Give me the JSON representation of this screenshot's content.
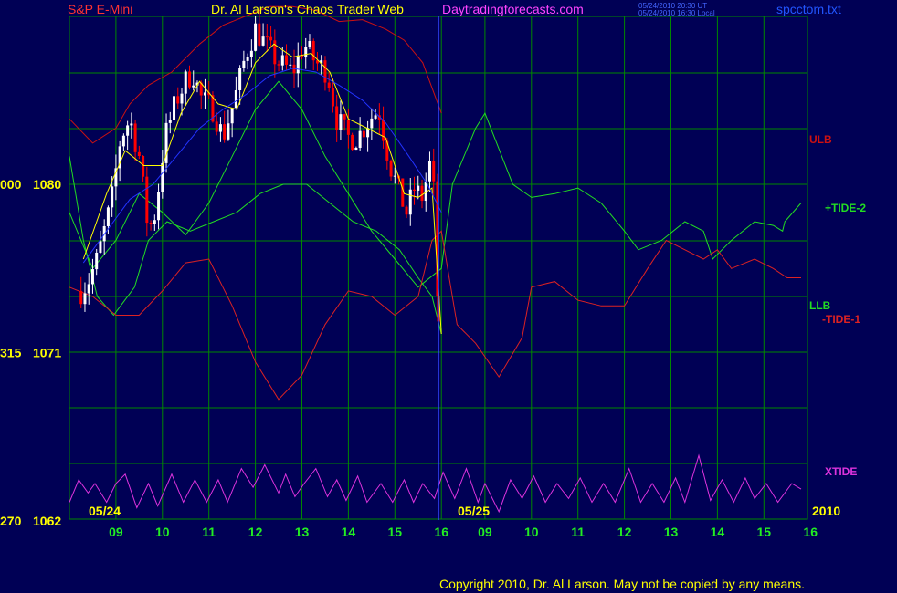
{
  "header": {
    "symbol": "S&P E-Mini",
    "title": "Dr. Al Larson's Chaos Trader Web",
    "site": "Daytradingforecasts.com",
    "timestamp_ut": "05/24/2010 20:30 UT",
    "timestamp_local": "05/24/2010 16:30 Local",
    "file": "spcctom.txt"
  },
  "copyright": "Copyright 2010, Dr. Al Larson. May not be copied by any means.",
  "colors": {
    "background": "#000055",
    "grid": "#008800",
    "symbol": "#ff3333",
    "title": "#ffff00",
    "site": "#ff44ff",
    "stamp": "#4466ff",
    "file": "#2255ff",
    "up_bar": "#ffffff",
    "down_bar": "#ff0000",
    "ulb": "#cc1111",
    "llb": "#22dd22",
    "tide_plus2": "#22dd22",
    "tide_minus1": "#dd2222",
    "xtide": "#dd33dd",
    "fast_avg": "#ffff00",
    "slow_avg": "#2233ff",
    "tick_green": "#22ee22",
    "tick_yellow": "#ffff00",
    "copyright": "#ffff00"
  },
  "chart_data": {
    "type": "candlestick",
    "title": "Dr. Al Larson's Chaos Trader Web",
    "y_ticks": [
      {
        "price": 1080,
        "left": "000",
        "label": "1080"
      },
      {
        "price": 1071,
        "left": "315",
        "label": "1071"
      },
      {
        "price": 1062,
        "left": "270",
        "label": "1062"
      }
    ],
    "hour_ticks": [
      "09",
      "10",
      "11",
      "12",
      "13",
      "14",
      "15",
      "16",
      "09",
      "10",
      "11",
      "12",
      "13",
      "14",
      "15",
      "16"
    ],
    "date_labels": [
      "05/24",
      "05/25",
      "2010"
    ],
    "series_labels": [
      "ULB",
      "+TIDE-2",
      "LLB",
      "-TIDE-1",
      "XTIDE"
    ],
    "grid": true,
    "price_bars": {
      "start_hour": 8.25,
      "end_hour": 16.0,
      "bar_minutes": 5,
      "keypoints": [
        [
          8.25,
          1074.3
        ],
        [
          8.4,
          1074.8
        ],
        [
          8.6,
          1076.0
        ],
        [
          8.9,
          1079.0
        ],
        [
          9.1,
          1082.5
        ],
        [
          9.3,
          1083.5
        ],
        [
          9.5,
          1081.5
        ],
        [
          9.7,
          1077.5
        ],
        [
          9.85,
          1078.5
        ],
        [
          10.05,
          1082.5
        ],
        [
          10.3,
          1084.5
        ],
        [
          10.5,
          1085.5
        ],
        [
          10.65,
          1086.0
        ],
        [
          10.85,
          1084.5
        ],
        [
          11.1,
          1084.0
        ],
        [
          11.3,
          1082.5
        ],
        [
          11.55,
          1084.5
        ],
        [
          11.8,
          1087.0
        ],
        [
          12.0,
          1088.3
        ],
        [
          12.2,
          1087.5
        ],
        [
          12.5,
          1086.5
        ],
        [
          12.8,
          1086.0
        ],
        [
          13.05,
          1087.5
        ],
        [
          13.3,
          1086.5
        ],
        [
          13.55,
          1086.0
        ],
        [
          13.75,
          1083.5
        ],
        [
          14.0,
          1082.5
        ],
        [
          14.2,
          1082.5
        ],
        [
          14.45,
          1083.5
        ],
        [
          14.65,
          1084.0
        ],
        [
          14.9,
          1081.0
        ],
        [
          15.1,
          1079.5
        ],
        [
          15.25,
          1078.5
        ],
        [
          15.45,
          1080.0
        ],
        [
          15.55,
          1079.0
        ],
        [
          15.7,
          1080.5
        ],
        [
          15.8,
          1081.5
        ],
        [
          15.88,
          1077.0
        ],
        [
          15.95,
          1071.5
        ],
        [
          16.0,
          1072.0
        ]
      ]
    },
    "lines": [
      {
        "label": "ULB",
        "points": [
          [
            8.0,
            1083.5
          ],
          [
            8.5,
            1082.2
          ],
          [
            9.0,
            1083.0
          ],
          [
            9.3,
            1084.3
          ],
          [
            9.7,
            1085.3
          ],
          [
            10.2,
            1086.0
          ],
          [
            10.8,
            1087.5
          ],
          [
            11.3,
            1088.5
          ],
          [
            11.8,
            1089.0
          ],
          [
            12.3,
            1089.5
          ],
          [
            12.8,
            1089.5
          ],
          [
            13.3,
            1089.3
          ],
          [
            13.8,
            1088.7
          ],
          [
            14.3,
            1088.8
          ],
          [
            14.8,
            1088.3
          ],
          [
            15.2,
            1087.7
          ],
          [
            15.6,
            1086.5
          ],
          [
            16.0,
            1083.8
          ]
        ]
      },
      {
        "label": "LLB",
        "points": [
          [
            8.0,
            1081.5
          ],
          [
            8.3,
            1077.0
          ],
          [
            8.6,
            1074.0
          ],
          [
            8.95,
            1073.0
          ],
          [
            9.4,
            1074.5
          ],
          [
            9.7,
            1077.0
          ],
          [
            10.1,
            1078.0
          ],
          [
            10.6,
            1077.5
          ],
          [
            11.1,
            1078.0
          ],
          [
            11.6,
            1078.5
          ],
          [
            12.1,
            1079.5
          ],
          [
            12.6,
            1080.0
          ],
          [
            13.1,
            1080.0
          ],
          [
            13.6,
            1079.0
          ],
          [
            14.1,
            1078.0
          ],
          [
            14.6,
            1077.5
          ],
          [
            15.1,
            1076.5
          ],
          [
            15.5,
            1075.0
          ],
          [
            15.8,
            1074.0
          ],
          [
            16.0,
            1072.0
          ]
        ]
      },
      {
        "label": "fast_avg",
        "points": [
          [
            8.3,
            1076.0
          ],
          [
            8.8,
            1079.5
          ],
          [
            9.2,
            1081.8
          ],
          [
            9.6,
            1081.0
          ],
          [
            10.0,
            1081.0
          ],
          [
            10.4,
            1083.8
          ],
          [
            10.8,
            1085.5
          ],
          [
            11.2,
            1084.3
          ],
          [
            11.6,
            1084.0
          ],
          [
            12.0,
            1086.5
          ],
          [
            12.4,
            1087.5
          ],
          [
            12.8,
            1086.8
          ],
          [
            13.2,
            1087.0
          ],
          [
            13.6,
            1086.0
          ],
          [
            14.0,
            1083.5
          ],
          [
            14.4,
            1083.0
          ],
          [
            14.8,
            1082.5
          ],
          [
            15.2,
            1079.5
          ],
          [
            15.5,
            1079.3
          ],
          [
            15.8,
            1079.8
          ],
          [
            16.0,
            1072.0
          ]
        ]
      },
      {
        "label": "slow_avg",
        "points": [
          [
            8.3,
            1075.8
          ],
          [
            8.8,
            1077.5
          ],
          [
            9.3,
            1079.2
          ],
          [
            9.8,
            1080.0
          ],
          [
            10.3,
            1081.5
          ],
          [
            10.8,
            1083.0
          ],
          [
            11.3,
            1084.0
          ],
          [
            11.8,
            1084.8
          ],
          [
            12.3,
            1085.8
          ],
          [
            12.8,
            1086.2
          ],
          [
            13.3,
            1086.0
          ],
          [
            13.8,
            1085.3
          ],
          [
            14.3,
            1084.5
          ],
          [
            14.8,
            1083.3
          ],
          [
            15.3,
            1081.5
          ],
          [
            15.7,
            1080.0
          ],
          [
            16.0,
            1078.5
          ]
        ]
      },
      {
        "label": "+TIDE-2",
        "points": [
          [
            8.0,
            1078.5
          ],
          [
            8.5,
            1075.5
          ],
          [
            9.0,
            1077.0
          ],
          [
            9.5,
            1079.5
          ],
          [
            10.0,
            1078.5
          ],
          [
            10.5,
            1077.3
          ],
          [
            11.0,
            1079.0
          ],
          [
            11.5,
            1081.5
          ],
          [
            12.0,
            1084.0
          ],
          [
            12.5,
            1085.5
          ],
          [
            13.0,
            1084.0
          ],
          [
            13.5,
            1081.5
          ],
          [
            14.0,
            1079.5
          ],
          [
            14.5,
            1077.5
          ],
          [
            15.0,
            1076.0
          ],
          [
            15.5,
            1074.5
          ],
          [
            16.0,
            1075.5
          ],
          [
            16.3,
            1080.0
          ],
          [
            16.8,
            1083.0
          ],
          [
            17.0,
            1083.8
          ],
          [
            17.6,
            1080.0
          ],
          [
            18.0,
            1079.3
          ],
          [
            18.5,
            1079.5
          ],
          [
            19.0,
            1079.8
          ],
          [
            19.5,
            1079.0
          ],
          [
            20.0,
            1077.5
          ],
          [
            20.3,
            1076.5
          ],
          [
            20.8,
            1077.0
          ],
          [
            21.3,
            1078.0
          ],
          [
            21.7,
            1077.5
          ],
          [
            21.9,
            1076.0
          ],
          [
            22.3,
            1077.0
          ],
          [
            22.8,
            1078.0
          ],
          [
            23.2,
            1077.8
          ],
          [
            23.4,
            1077.5
          ],
          [
            23.45,
            1078.0
          ],
          [
            23.8,
            1079.0
          ]
        ]
      },
      {
        "label": "-TIDE-1",
        "points": [
          [
            8.0,
            1074.5
          ],
          [
            8.5,
            1074.0
          ],
          [
            9.0,
            1073.0
          ],
          [
            9.5,
            1073.0
          ],
          [
            10.0,
            1074.3
          ],
          [
            10.5,
            1075.8
          ],
          [
            11.0,
            1076.0
          ],
          [
            11.5,
            1073.5
          ],
          [
            12.0,
            1070.5
          ],
          [
            12.5,
            1068.5
          ],
          [
            13.0,
            1069.8
          ],
          [
            13.5,
            1072.5
          ],
          [
            14.0,
            1074.3
          ],
          [
            14.5,
            1074.0
          ],
          [
            15.0,
            1073.0
          ],
          [
            15.5,
            1074.0
          ],
          [
            15.8,
            1077.0
          ],
          [
            16.0,
            1077.5
          ],
          [
            16.4,
            1072.5
          ],
          [
            16.8,
            1071.5
          ],
          [
            17.3,
            1069.7
          ],
          [
            17.8,
            1071.8
          ],
          [
            18.0,
            1074.5
          ],
          [
            18.5,
            1074.8
          ],
          [
            19.0,
            1073.8
          ],
          [
            19.5,
            1073.5
          ],
          [
            20.0,
            1073.5
          ],
          [
            20.5,
            1075.5
          ],
          [
            20.9,
            1077.0
          ],
          [
            21.3,
            1076.5
          ],
          [
            21.7,
            1076.0
          ],
          [
            22.0,
            1076.5
          ],
          [
            22.3,
            1075.5
          ],
          [
            22.8,
            1076.0
          ],
          [
            23.2,
            1075.5
          ],
          [
            23.5,
            1075.0
          ],
          [
            23.8,
            1075.0
          ]
        ]
      },
      {
        "label": "XTIDE",
        "points": [
          [
            8.0,
            1063.0
          ],
          [
            8.2,
            1064.2
          ],
          [
            8.4,
            1063.5
          ],
          [
            8.55,
            1064.0
          ],
          [
            8.8,
            1063.0
          ],
          [
            9.0,
            1064.0
          ],
          [
            9.2,
            1064.5
          ],
          [
            9.45,
            1062.7
          ],
          [
            9.7,
            1064.0
          ],
          [
            9.9,
            1062.8
          ],
          [
            10.2,
            1064.5
          ],
          [
            10.45,
            1063.0
          ],
          [
            10.7,
            1064.2
          ],
          [
            10.95,
            1063.0
          ],
          [
            11.2,
            1064.2
          ],
          [
            11.4,
            1063.0
          ],
          [
            11.7,
            1064.8
          ],
          [
            11.95,
            1063.8
          ],
          [
            12.2,
            1065.0
          ],
          [
            12.5,
            1063.5
          ],
          [
            12.65,
            1064.5
          ],
          [
            12.85,
            1063.3
          ],
          [
            13.05,
            1064.0
          ],
          [
            13.3,
            1064.8
          ],
          [
            13.55,
            1063.3
          ],
          [
            13.75,
            1064.2
          ],
          [
            13.95,
            1063.1
          ],
          [
            14.2,
            1064.4
          ],
          [
            14.4,
            1063.0
          ],
          [
            14.7,
            1064.0
          ],
          [
            14.95,
            1063.0
          ],
          [
            15.2,
            1064.2
          ],
          [
            15.4,
            1063.0
          ],
          [
            15.6,
            1064.0
          ],
          [
            15.85,
            1063.2
          ],
          [
            16.1,
            1064.6
          ],
          [
            16.35,
            1063.2
          ],
          [
            16.6,
            1064.8
          ],
          [
            16.85,
            1063.0
          ],
          [
            17.0,
            1064.0
          ],
          [
            17.3,
            1062.5
          ],
          [
            17.55,
            1064.2
          ],
          [
            17.8,
            1063.2
          ],
          [
            18.05,
            1064.4
          ],
          [
            18.3,
            1063.0
          ],
          [
            18.55,
            1064.0
          ],
          [
            18.8,
            1063.2
          ],
          [
            19.05,
            1064.3
          ],
          [
            19.3,
            1063.0
          ],
          [
            19.55,
            1064.0
          ],
          [
            19.8,
            1063.0
          ],
          [
            20.1,
            1064.8
          ],
          [
            20.35,
            1063.0
          ],
          [
            20.6,
            1064.0
          ],
          [
            20.85,
            1063.0
          ],
          [
            21.1,
            1064.3
          ],
          [
            21.3,
            1063.0
          ],
          [
            21.6,
            1065.5
          ],
          [
            21.85,
            1063.1
          ],
          [
            22.1,
            1064.2
          ],
          [
            22.35,
            1063.0
          ],
          [
            22.6,
            1064.3
          ],
          [
            22.8,
            1063.2
          ],
          [
            23.05,
            1064.0
          ],
          [
            23.3,
            1063.0
          ],
          [
            23.6,
            1064.0
          ],
          [
            23.8,
            1063.7
          ]
        ]
      }
    ]
  }
}
